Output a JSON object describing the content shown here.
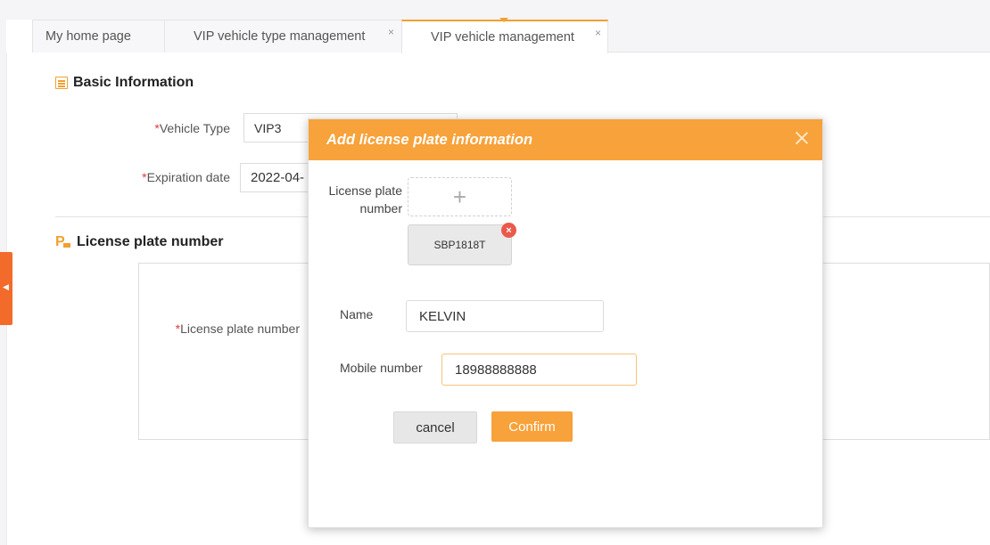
{
  "tabs": [
    {
      "label": "My home page",
      "closable": false,
      "active": false
    },
    {
      "label": "VIP vehicle type management",
      "closable": true,
      "active": false
    },
    {
      "label": "VIP vehicle management",
      "closable": true,
      "active": true
    }
  ],
  "tab_close_glyph": "×",
  "basic_info": {
    "title": "Basic Information",
    "icon": "list-icon",
    "vehicle_type": {
      "required_mark": "*",
      "label": "Vehicle Type",
      "value": "VIP3"
    },
    "expiration_date": {
      "required_mark": "*",
      "label": "Expiration date",
      "value": "2022-04-"
    }
  },
  "plate_section": {
    "title": "License plate number",
    "icon": "parking-icon",
    "field": {
      "required_mark": "*",
      "label": "License plate number"
    }
  },
  "modal": {
    "title": "Add license plate information",
    "plate_label_line1": "License plate",
    "plate_label_line2": "number",
    "upload_glyph": "+",
    "plates": [
      "SBP1818T"
    ],
    "remove_glyph": "×",
    "name_label": "Name",
    "name_value": "KELVIN",
    "mobile_label": "Mobile number",
    "mobile_value": "18988888888",
    "cancel_label": "cancel",
    "confirm_label": "Confirm"
  },
  "colors": {
    "accent": "#f7a23a",
    "required": "#e4393c",
    "side_handle": "#f26b2a"
  }
}
